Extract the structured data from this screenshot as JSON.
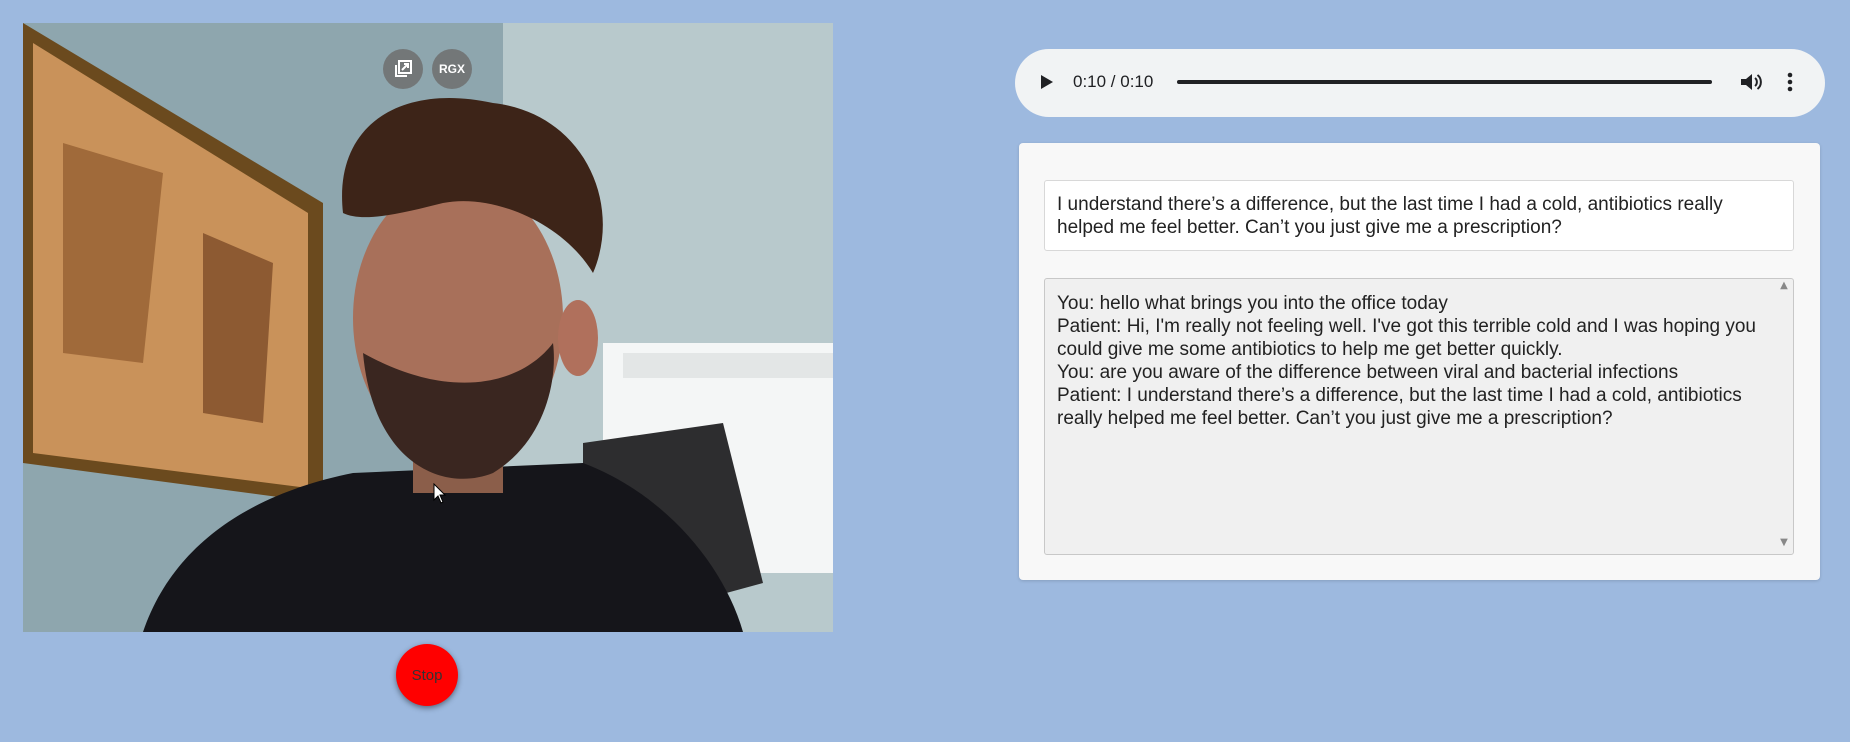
{
  "video": {
    "popout_label": "",
    "rgx_label": "RGX"
  },
  "stop_button": {
    "label": "Stop"
  },
  "audio": {
    "time": "0:10 / 0:10",
    "progress": 1.0
  },
  "latest_reply": "I understand there’s a difference, but the last time I had a cold, antibiotics really helped me feel better. Can’t you just give me a prescription?",
  "transcript": [
    "You: hello what brings you into the office today",
    "Patient: Hi, I'm really not feeling well. I've got this terrible cold and I was hoping you could give me some antibiotics to help me get better quickly.",
    "You: are you aware of the difference between viral and bacterial infections",
    "Patient: I understand there’s a difference, but the last time I had a cold, antibiotics really helped me feel better. Can’t you just give me a prescription?"
  ],
  "colors": {
    "background": "#9db9df",
    "stop": "#ff0000",
    "audio_bg": "#f1f3f4"
  },
  "icons": [
    "popout-icon",
    "play-icon",
    "volume-icon",
    "more-vert-icon",
    "scroll-up-icon",
    "scroll-down-icon"
  ]
}
